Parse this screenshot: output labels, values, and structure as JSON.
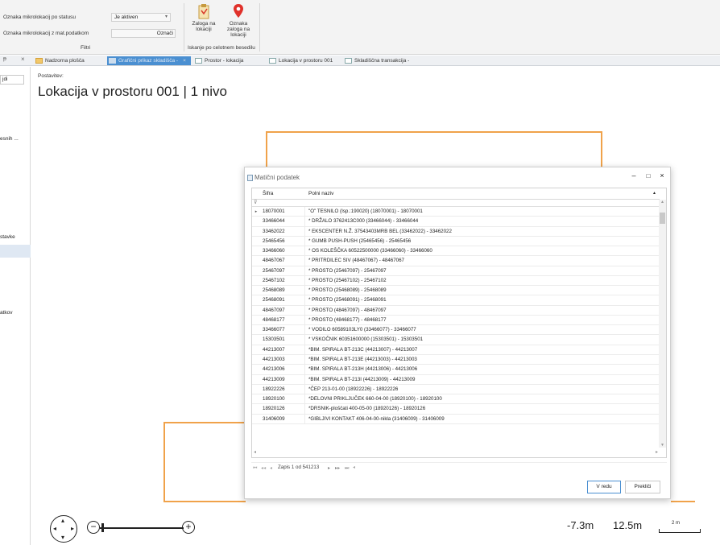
{
  "ribbon": {
    "filter1_label": "Oznaka mikrolokacij po statusu",
    "filter1_value": "Je aktiven",
    "filter2_label": "Oznaka mikrolokacij z mat.podatkom",
    "filter2_button": "Označi",
    "filter_group": "Filtri",
    "btn_zaloga_na_lokaciji": "Zaloga na lokaciji",
    "btn_oznaka_zaloga": "Oznaka zaloga na lokaciji",
    "search_group": "Iskanje po celotnem besedilu"
  },
  "tabs": [
    {
      "label": "Nadzorna plošča"
    },
    {
      "label": "Grafični prikaz skladišča -"
    },
    {
      "label": "Prostor - lokacija"
    },
    {
      "label": "Lokacija v prostoru 001"
    },
    {
      "label": "Skladiščna transakcija -"
    }
  ],
  "tabbar_left": {
    "pin": "ᵽ",
    "close": "×"
  },
  "left_panel": {
    "btn": "jdi",
    "item1": "esnih ...",
    "item2": "stavke",
    "item3": "atkov"
  },
  "main": {
    "postavitev": "Postavitev:",
    "title": "Lokacija v prostoru 001 | 1 nivo"
  },
  "dialog": {
    "title": "Matični podatek",
    "col_sifra": "Šifra",
    "col_polni_naziv": "Polni naziv",
    "rows": [
      {
        "sifra": "18070001",
        "naziv": "\"O\" TESNILO  (Isp.:190020) (18070001) - 18070001"
      },
      {
        "sifra": "33466044",
        "naziv": "* DRŽALO  3762413C000 (33466044) - 33466044"
      },
      {
        "sifra": "33462022",
        "naziv": "* EKSCENTER N.Ž. 37543403MRB BEL (33462022) - 33462022"
      },
      {
        "sifra": "25465456",
        "naziv": "* GUMB PUSH-PUSH (25465456) - 25465456"
      },
      {
        "sifra": "33466060",
        "naziv": "* OS KOLEŠČKA  60522500000 (33466060) - 33466060"
      },
      {
        "sifra": "48467067",
        "naziv": "* PRITRDILEC SIV (48467067) - 48467067"
      },
      {
        "sifra": "25467097",
        "naziv": "* PROSTO (25467097) - 25467097"
      },
      {
        "sifra": "25467102",
        "naziv": "* PROSTO (25467102) - 25467102"
      },
      {
        "sifra": "25468089",
        "naziv": "* PROSTO (25468089) - 25468089"
      },
      {
        "sifra": "25468091",
        "naziv": "* PROSTO (25468091) - 25468091"
      },
      {
        "sifra": "48467097",
        "naziv": "* PROSTO (48467097) - 48467097"
      },
      {
        "sifra": "48468177",
        "naziv": "* PROSTO (48468177) - 48468177"
      },
      {
        "sifra": "33466077",
        "naziv": "* VODILO  60589103LY0 (33466077) - 33466077"
      },
      {
        "sifra": "15303501",
        "naziv": "* VSKOČNIK  60351600000 (15303501) - 15303501"
      },
      {
        "sifra": "44213007",
        "naziv": "*BIM. SPIRALA BT-213C (44213007) - 44213007"
      },
      {
        "sifra": "44213003",
        "naziv": "*BIM. SPIRALA BT-213E (44213003) - 44213003"
      },
      {
        "sifra": "44213006",
        "naziv": "*BIM. SPIRALA BT-213H (44213006) - 44213006"
      },
      {
        "sifra": "44213009",
        "naziv": "*BIM. SPIRALA BT-213I (44213009) - 44213009"
      },
      {
        "sifra": "18922226",
        "naziv": "*ČEP              213-01-00 (18922226) - 18922226"
      },
      {
        "sifra": "18920100",
        "naziv": "*DELOVNI PRIKLJUČEK  660-04-00 (18920100) - 18920100"
      },
      {
        "sifra": "18920126",
        "naziv": "*DRSNIK-ploščati    400-05-00 (18920126) - 18920126"
      },
      {
        "sifra": "31406009",
        "naziv": "*GIBLJIVI KONTAKT  406-04-00-nikla (31406009) - 31406009"
      }
    ],
    "record_text": "Zapis 1 od 541213",
    "btn_ok": "V redu",
    "btn_cancel": "Prekliči"
  },
  "map": {
    "coord_x": "-7.3m",
    "coord_y": "12.5m",
    "scale": "2 m"
  },
  "colors": {
    "accent": "#4a8fd1",
    "outline": "#f0a24a"
  }
}
